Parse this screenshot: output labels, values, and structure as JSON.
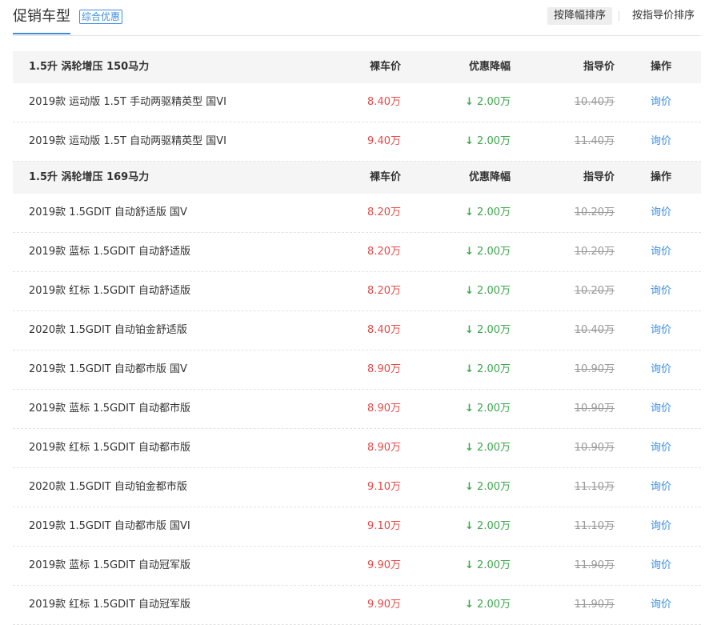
{
  "header": {
    "title": "促销车型",
    "badge": "综合优惠",
    "sort_options": [
      "按降幅排序",
      "按指导价排序"
    ]
  },
  "columns": {
    "bare_price": "裸车价",
    "discount": "优惠降幅",
    "guide_price": "指导价",
    "action": "操作"
  },
  "groups": [
    {
      "title": "1.5升 涡轮增压 150马力",
      "rows": [
        {
          "name": "2019款 运动版 1.5T 手动两驱精英型 国VI",
          "price": "8.40万",
          "discount": "2.00万",
          "guide": "10.40万",
          "action": "询价"
        },
        {
          "name": "2019款 运动版 1.5T 自动两驱精英型 国VI",
          "price": "9.40万",
          "discount": "2.00万",
          "guide": "11.40万",
          "action": "询价"
        }
      ]
    },
    {
      "title": "1.5升 涡轮增压 169马力",
      "rows": [
        {
          "name": "2019款 1.5GDIT 自动舒适版 国V",
          "price": "8.20万",
          "discount": "2.00万",
          "guide": "10.20万",
          "action": "询价"
        },
        {
          "name": "2019款 蓝标 1.5GDIT 自动舒适版",
          "price": "8.20万",
          "discount": "2.00万",
          "guide": "10.20万",
          "action": "询价"
        },
        {
          "name": "2019款 红标 1.5GDIT 自动舒适版",
          "price": "8.20万",
          "discount": "2.00万",
          "guide": "10.20万",
          "action": "询价"
        },
        {
          "name": "2020款 1.5GDIT 自动铂金舒适版",
          "price": "8.40万",
          "discount": "2.00万",
          "guide": "10.40万",
          "action": "询价"
        },
        {
          "name": "2019款 1.5GDIT 自动都市版 国V",
          "price": "8.90万",
          "discount": "2.00万",
          "guide": "10.90万",
          "action": "询价"
        },
        {
          "name": "2019款 蓝标 1.5GDIT 自动都市版",
          "price": "8.90万",
          "discount": "2.00万",
          "guide": "10.90万",
          "action": "询价"
        },
        {
          "name": "2019款 红标 1.5GDIT 自动都市版",
          "price": "8.90万",
          "discount": "2.00万",
          "guide": "10.90万",
          "action": "询价"
        },
        {
          "name": "2020款 1.5GDIT 自动铂金都市版",
          "price": "9.10万",
          "discount": "2.00万",
          "guide": "11.10万",
          "action": "询价"
        },
        {
          "name": "2019款 1.5GDIT 自动都市版 国VI",
          "price": "9.10万",
          "discount": "2.00万",
          "guide": "11.10万",
          "action": "询价"
        },
        {
          "name": "2019款 蓝标 1.5GDIT 自动冠军版",
          "price": "9.90万",
          "discount": "2.00万",
          "guide": "11.90万",
          "action": "询价"
        },
        {
          "name": "2019款 红标 1.5GDIT 自动冠军版",
          "price": "9.90万",
          "discount": "2.00万",
          "guide": "11.90万",
          "action": "询价"
        }
      ]
    }
  ],
  "icons": {
    "discount_arrow": "down-arrow-icon"
  },
  "colors": {
    "accent": "#3e8ee0",
    "price": "#e84a48",
    "discount": "#3ba84b",
    "guide": "#999999"
  }
}
